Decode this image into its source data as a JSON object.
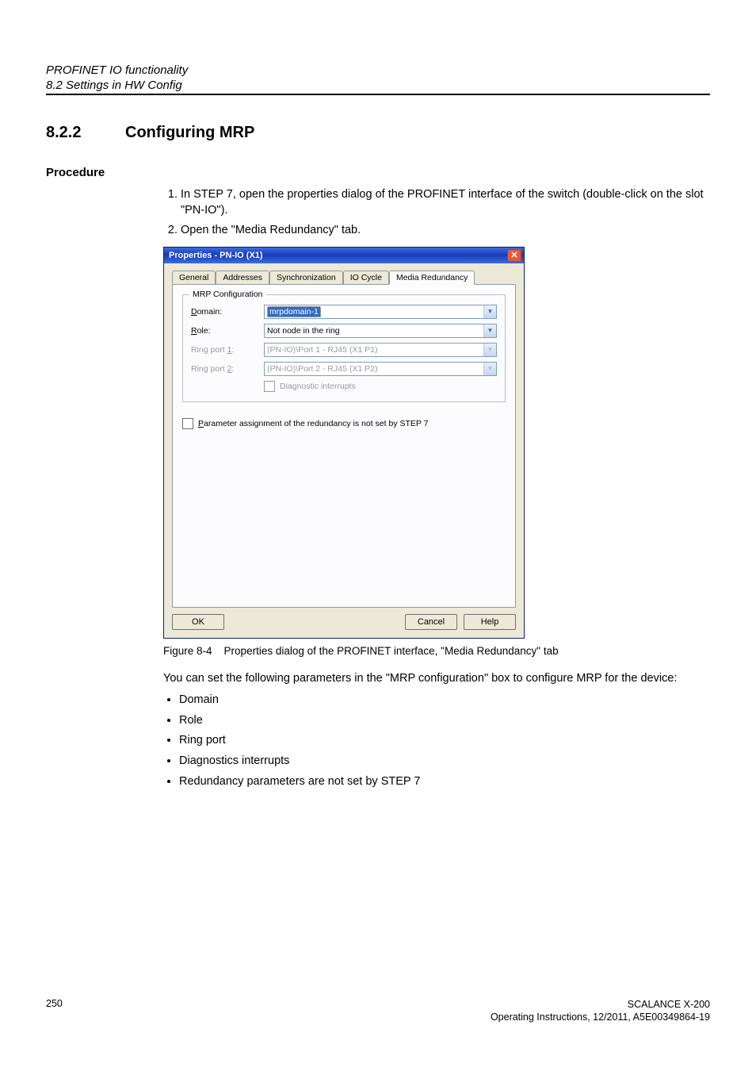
{
  "header": {
    "title": "PROFINET IO functionality",
    "subtitle": "8.2 Settings in HW Config"
  },
  "section": {
    "number": "8.2.2",
    "title": "Configuring MRP"
  },
  "procedure": {
    "heading": "Procedure",
    "steps": [
      "In STEP 7, open the properties dialog of the PROFINET interface of the switch (double-click on the slot \"PN-IO\").",
      "Open the \"Media Redundancy\" tab."
    ]
  },
  "dialog": {
    "title": "Properties - PN-IO (X1)",
    "tabs": [
      "General",
      "Addresses",
      "Synchronization",
      "IO Cycle",
      "Media Redundancy"
    ],
    "active_tab": "Media Redundancy",
    "groupbox_title": "MRP Configuration",
    "fields": {
      "domain": {
        "label": "Domain:",
        "label_access": "D",
        "value": "mrpdomain-1"
      },
      "role": {
        "label": "Role:",
        "label_access": "R",
        "value": "Not node in the ring"
      },
      "ringport1": {
        "label": "Ring port 1:",
        "label_access": "1",
        "value": "(PN-IO)\\Port 1 - RJ45 (X1 P1)"
      },
      "ringport2": {
        "label": "Ring port 2:",
        "label_access": "2",
        "value": "(PN-IO)\\Port 2 - RJ45 (X1 P2)"
      },
      "diag": "Diagnostic interrupts"
    },
    "outer_checkbox": "Parameter assignment of the redundancy is not set by STEP 7",
    "outer_checkbox_access": "P",
    "buttons": {
      "ok": "OK",
      "cancel": "Cancel",
      "help": "Help"
    }
  },
  "figure": {
    "label": "Figure 8-4",
    "caption": "Properties dialog of the PROFINET interface, \"Media Redundancy\" tab"
  },
  "after_figure": "You can set the following parameters in the \"MRP configuration\" box to configure MRP for the device:",
  "bullets": [
    "Domain",
    "Role",
    "Ring port",
    "Diagnostics interrupts",
    "Redundancy parameters are not set by STEP 7"
  ],
  "footer": {
    "page": "250",
    "doc_title": "SCALANCE X-200",
    "doc_info": "Operating Instructions, 12/2011, A5E00349864-19"
  }
}
